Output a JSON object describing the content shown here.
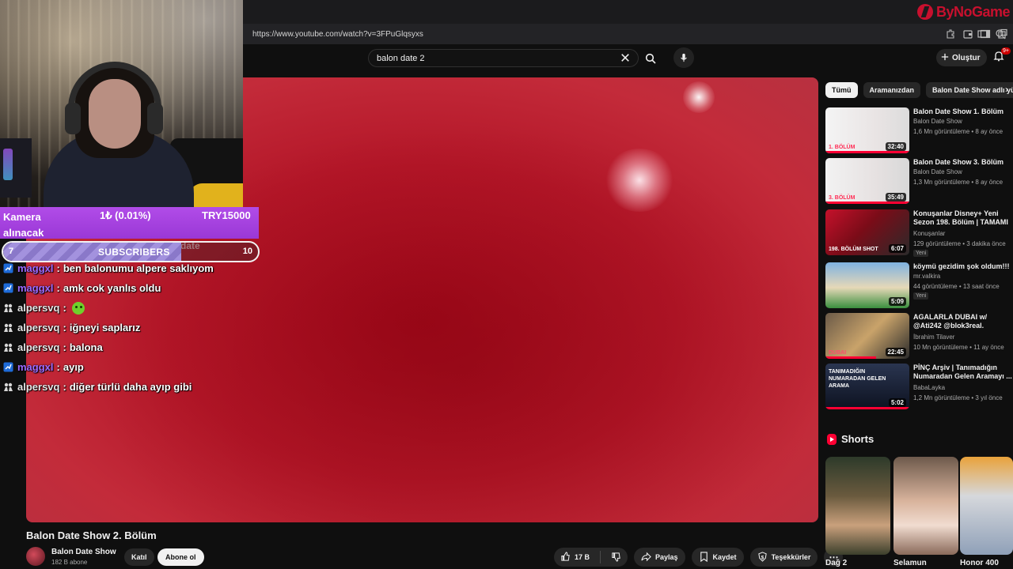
{
  "watermark": {
    "text": "ByNoGame"
  },
  "browser": {
    "url": "https://www.youtube.com/watch?v=3FPuGlqsyxs"
  },
  "header": {
    "search_value": "balon date 2",
    "create_label": "Oluştur",
    "notification_count": "9+"
  },
  "overlay": {
    "donation": {
      "title": "Kamera alınacak",
      "percent": "1₺ (0.01%)",
      "amount": "TRY15000"
    },
    "subscribers": {
      "current": "7",
      "label": "SUBSCRIBERS",
      "target": "10",
      "ghost_text": "date",
      "progress": 0.7
    },
    "chat": [
      {
        "user": "maggxl",
        "badge": "prime",
        "message": "ben balonumu alpere saklıyom"
      },
      {
        "user": "maggxl",
        "badge": "prime",
        "message": "amk cok yanlıs oldu"
      },
      {
        "user": "alpersvq",
        "badge": "group",
        "message": "",
        "emote": "green-face-emote"
      },
      {
        "user": "alpersvq",
        "badge": "group",
        "message": "iğneyi saplarız"
      },
      {
        "user": "alpersvq",
        "badge": "group",
        "message": "balona"
      },
      {
        "user": "maggxl",
        "badge": "prime",
        "message": "ayıp"
      },
      {
        "user": "alpersvq",
        "badge": "group",
        "message": "diğer türlü daha ayıp gibi"
      }
    ],
    "chat_separator": ":"
  },
  "video": {
    "title": "Balon Date Show 2. Bölüm",
    "channel": "Balon Date Show",
    "subscribers": "182 B abone",
    "join_label": "Katıl",
    "subscribe_label": "Abone ol",
    "likes": "17 B",
    "share_label": "Paylaş",
    "save_label": "Kaydet",
    "thanks_label": "Teşekkürler"
  },
  "sidebar": {
    "chips": [
      "Tümü",
      "Aramanızdan",
      "Balon Date Show adlı yü"
    ],
    "recommendations": [
      {
        "title": "Balon Date Show 1. Bölüm",
        "channel": "Balon Date Show",
        "meta": "1,6 Mn görüntüleme • 8 ay önce",
        "duration": "32:40",
        "thumb_label": "1. BÖLÜM",
        "new": ""
      },
      {
        "title": "Balon Date Show 3. Bölüm",
        "channel": "Balon Date Show",
        "meta": "1,3 Mn görüntüleme • 8 ay önce",
        "duration": "35:49",
        "thumb_label": "3. BÖLÜM",
        "new": ""
      },
      {
        "title": "Konuşanlar Disney+ Yeni Sezon 198. Bölüm | TAMAMI ...",
        "channel": "Konuşanlar",
        "meta": "129 görüntüleme • 3 dakika önce",
        "duration": "6:07",
        "thumb_label": "198. BÖLÜM SHOT",
        "new": "Yeni"
      },
      {
        "title": "köymü gezidim şok oldum!!!",
        "channel": "mr.valkira",
        "meta": "44 görüntüleme • 13 saat önce",
        "duration": "5:09",
        "thumb_label": "",
        "new": "Yeni"
      },
      {
        "title": "AGALARLA DUBAI w/ @Ati242 @blok3real.",
        "channel": "İbrahim Tilaver",
        "meta": "10 Mn görüntüleme • 11 ay önce",
        "duration": "22:45",
        "thumb_label": "DUBAI",
        "new": ""
      },
      {
        "title": "PİNÇ Arşiv | Tanımadığın Numaradan Gelen Aramayı ...",
        "channel": "BabaLayka",
        "meta": "1,2 Mn görüntüleme • 3 yıl önce",
        "duration": "5:02",
        "thumb_label": "TANIMADIĞIN NUMARADAN GELEN ARAMA",
        "new": ""
      }
    ],
    "shorts_title": "Shorts",
    "shorts": [
      {
        "label": "Dağ 2"
      },
      {
        "label": "Selamun"
      },
      {
        "label": "Honor 400"
      }
    ]
  },
  "colors": {
    "brand_red": "#ff0033",
    "donation_purple": "#b14ce8",
    "chat_user_purple": "#9c6bff"
  }
}
